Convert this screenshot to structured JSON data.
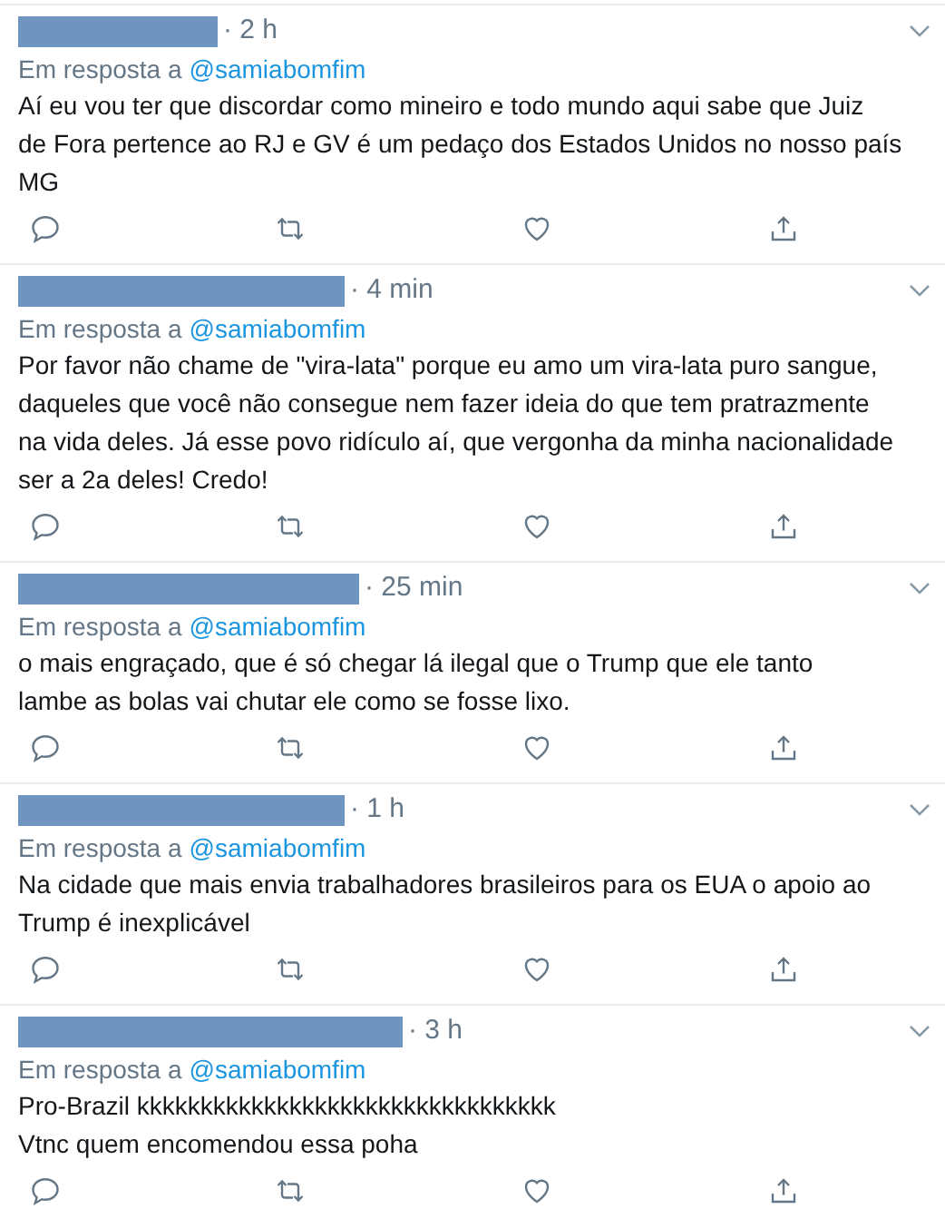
{
  "replies": [
    {
      "time": "· 2 h",
      "reply_label": "Em resposta a",
      "reply_to": "@samiabomfim",
      "body": "Aí eu vou ter que discordar como mineiro e todo mundo aqui sabe que Juiz\nde Fora pertence ao RJ e GV é um pedaço dos Estados Unidos no nosso país\nMG"
    },
    {
      "time": "· 4 min",
      "reply_label": "Em resposta a",
      "reply_to": "@samiabomfim",
      "body": "Por favor não chame de \"vira-lata\" porque eu amo um vira-lata puro sangue,\ndaqueles que você não consegue nem fazer ideia do que tem pratrazmente\nna vida deles. Já esse povo ridículo aí, que vergonha da minha nacionalidade\nser a 2a deles! Credo!"
    },
    {
      "time": "· 25 min",
      "reply_label": "Em resposta a",
      "reply_to": "@samiabomfim",
      "body": "o mais engraçado, que é só chegar lá ilegal que o Trump que ele tanto\nlambe as bolas vai chutar ele como se fosse lixo."
    },
    {
      "time": "· 1 h",
      "reply_label": "Em resposta a",
      "reply_to": "@samiabomfim",
      "body": "Na cidade que mais envia trabalhadores brasileiros para os EUA o apoio ao\nTrump é inexplicável"
    },
    {
      "time": "· 3 h",
      "reply_label": "Em resposta a",
      "reply_to": "@samiabomfim",
      "body": "Pro-Brazil kkkkkkkkkkkkkkkkkkkkkkkkkkkkkkkkk\nVtnc quem encomendou essa poha"
    }
  ]
}
